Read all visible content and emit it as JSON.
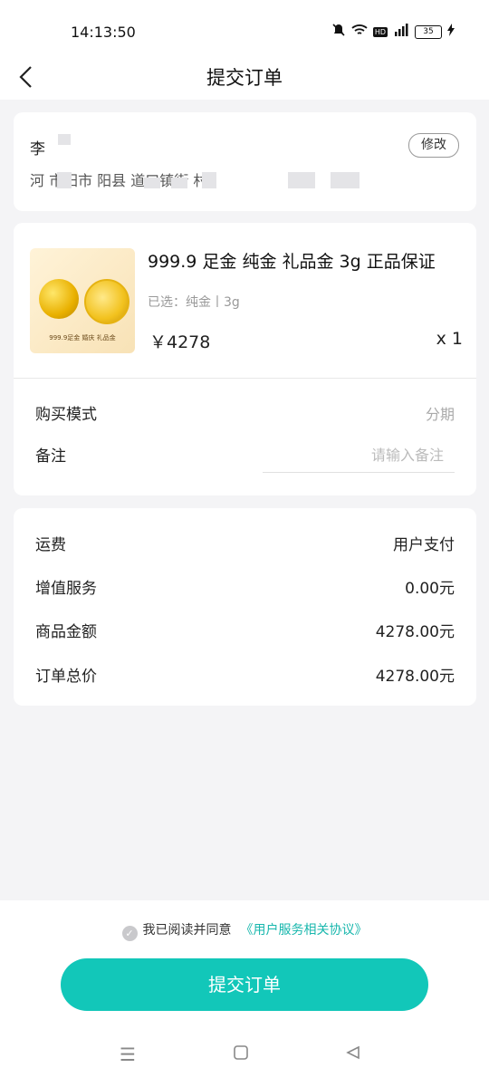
{
  "status_bar": {
    "time": "14:13:50",
    "battery": "35"
  },
  "header": {
    "title": "提交订单"
  },
  "address": {
    "name": "李",
    "address_line": "河   市阳市 阳县 道口镇街 村",
    "edit_label": "修改"
  },
  "product": {
    "title": "999.9 足金 纯金 礼品金 3g 正品保证",
    "spec": "已选：纯金丨3g",
    "price": "￥4278",
    "quantity": "x 1",
    "image_caption": "999.9足金 婚庆 礼品金"
  },
  "order_options": {
    "purchase_mode_label": "购买模式",
    "purchase_mode_value": "分期",
    "remark_label": "备注",
    "remark_placeholder": "请输入备注",
    "remark_value": ""
  },
  "fees": [
    {
      "label": "运费",
      "value": "用户支付"
    },
    {
      "label": "增值服务",
      "value": "0.00元"
    },
    {
      "label": "商品金额",
      "value": "4278.00元"
    },
    {
      "label": "订单总价",
      "value": "4278.00元"
    }
  ],
  "agreement": {
    "text": "我已阅读并同意",
    "link": "《用户服务相关协议》"
  },
  "submit_label": "提交订单",
  "colors": {
    "accent": "#12c7b9",
    "link": "#18b7ad",
    "background": "#f4f4f6"
  },
  "icons": [
    "back-arrow-icon",
    "mute-icon",
    "wifi-icon",
    "signal-icon",
    "battery-icon",
    "check-circle-icon",
    "menu-icon",
    "home-icon",
    "back-triangle-icon"
  ]
}
